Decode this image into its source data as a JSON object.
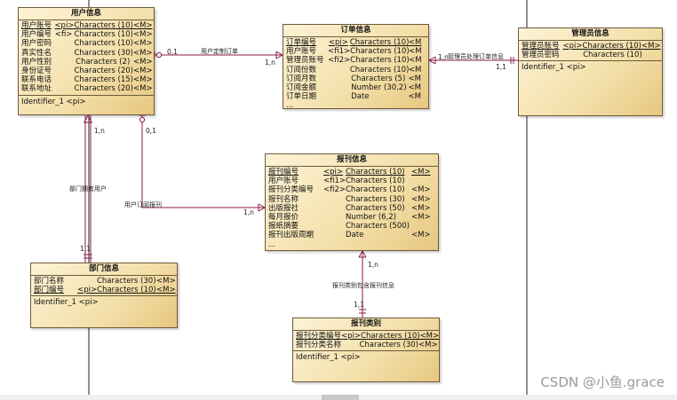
{
  "entities": {
    "user": {
      "title": "用户信息",
      "rows": [
        {
          "name": "用户账号",
          "key": "<pi>",
          "type": "Characters (10)",
          "m": "<M>"
        },
        {
          "name": "用户编号",
          "key": "<fi>",
          "type": "Characters (10)",
          "m": "<M>"
        },
        {
          "name": "用户密码",
          "key": "",
          "type": "Characters (10)",
          "m": "<M>"
        },
        {
          "name": "真实性名",
          "key": "",
          "type": "Characters (30)",
          "m": "<M>"
        },
        {
          "name": "用户性别",
          "key": "",
          "type": "Characters (2)",
          "m": "<M>"
        },
        {
          "name": "身份证号",
          "key": "",
          "type": "Characters (20)",
          "m": "<M>"
        },
        {
          "name": "联系电话",
          "key": "",
          "type": "Characters (15)",
          "m": "<M>"
        },
        {
          "name": "联系地址",
          "key": "",
          "type": "Characters (20)",
          "m": "<M>"
        }
      ],
      "identifier": "Identifier_1  <pi>"
    },
    "order": {
      "title": "订单信息",
      "rows": [
        {
          "name": "订单编号",
          "key": "<pi>",
          "type": "Characters (10)",
          "m": "<M"
        },
        {
          "name": "用户账号",
          "key": "<fi1>",
          "type": "Characters (10)",
          "m": "<M"
        },
        {
          "name": "管理员账号",
          "key": "<fi2>",
          "type": "Characters (10)",
          "m": "<M"
        },
        {
          "name": "订阅份数",
          "key": "",
          "type": "Characters (10)",
          "m": "<M"
        },
        {
          "name": "订阅月数",
          "key": "",
          "type": "Characters (5)",
          "m": "<M"
        },
        {
          "name": "订阅金额",
          "key": "",
          "type": "Number (30,2)",
          "m": "<M"
        },
        {
          "name": "订单日期",
          "key": "",
          "type": "Date",
          "m": "<M"
        }
      ],
      "ellipsis": "..."
    },
    "admin": {
      "title": "管理员信息",
      "rows": [
        {
          "name": "管理员账号",
          "key": "<pi>",
          "type": "Characters (10)",
          "m": "<M>"
        },
        {
          "name": "管理员密码",
          "key": "",
          "type": "Characters (10)",
          "m": ""
        }
      ],
      "identifier": "Identifier_1  <pi>"
    },
    "newspaper": {
      "title": "报刊信息",
      "rows": [
        {
          "name": "报刊编号",
          "key": "<pi>",
          "type": "Characters (10)",
          "m": "<M>"
        },
        {
          "name": "用户账号",
          "key": "<fi1>",
          "type": "Characters (10)",
          "m": ""
        },
        {
          "name": "报刊分类编号",
          "key": "<fi2>",
          "type": "Characters (10)",
          "m": "<M>"
        },
        {
          "name": "报刊名称",
          "key": "",
          "type": "Characters (30)",
          "m": "<M>"
        },
        {
          "name": "出版报社",
          "key": "",
          "type": "Characters (50)",
          "m": "<M>"
        },
        {
          "name": "每月报价",
          "key": "",
          "type": "Number (6,2)",
          "m": "<M>"
        },
        {
          "name": "报纸摘要",
          "key": "",
          "type": "Characters (500)",
          "m": ""
        },
        {
          "name": "报刊出版周期",
          "key": "",
          "type": "Date",
          "m": "<M>"
        }
      ],
      "ellipsis": "..."
    },
    "department": {
      "title": "部门信息",
      "rows": [
        {
          "name": "部门名称",
          "key": "",
          "type": "Characters (30)",
          "m": "<M>"
        },
        {
          "name": "部门编号",
          "key": "<pi>",
          "type": "Characters (10)",
          "m": "<M>"
        }
      ],
      "identifier": "Identifier_1  <pi>"
    },
    "category": {
      "title": "报刊类别",
      "rows": [
        {
          "name": "报刊分类编号",
          "key": "<pi>",
          "type": "Characters (10)",
          "m": "<M>"
        },
        {
          "name": "报刊分类名称",
          "key": "",
          "type": "Characters (30)",
          "m": "<M>"
        }
      ],
      "identifier": "Identifier_1  <pi>"
    }
  },
  "relationships": {
    "user_order": {
      "label": "用户定制订单",
      "card_a": "0,1",
      "card_b": "1,n"
    },
    "admin_order": {
      "label": "管理员处理订单信息",
      "card_a": "1,n",
      "card_b": "1,1"
    },
    "dept_user": {
      "label": "部门拥有用户",
      "card_a": "1,n",
      "card_b": "1,1"
    },
    "user_news": {
      "label": "用户订阅报刊",
      "card_a": "0,1",
      "card_b": "1,n"
    },
    "cat_news": {
      "label": "报刊类别包含报刊信息",
      "card_a": "1,n",
      "card_b": "1,1"
    }
  },
  "watermark": "CSDN @小鱼.grace",
  "colors": {
    "line": "#8b1a4a",
    "border": "#6d5a3a",
    "fill": "#f3dfa8"
  }
}
